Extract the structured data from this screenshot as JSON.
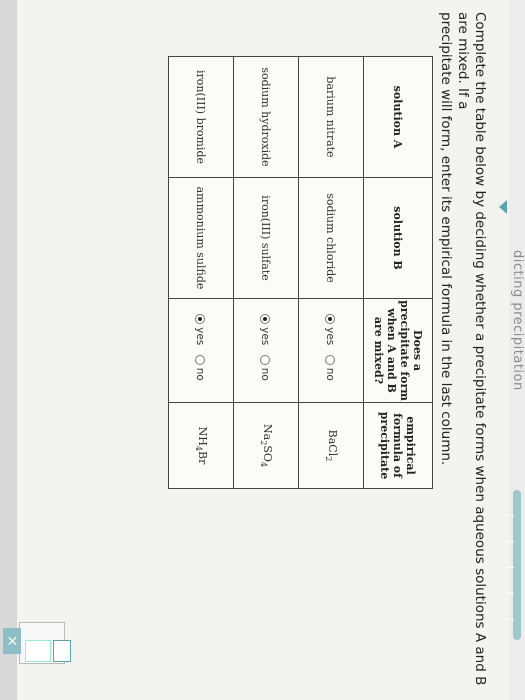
{
  "header": {
    "title": "dicting precipitation"
  },
  "instructions": {
    "line1": "Complete the table below by deciding whether a precipitate forms when aqueous solutions A and B are mixed. If a",
    "line2": "precipitate will form, enter its empirical formula in the last column."
  },
  "table": {
    "headers": {
      "col1": "solution A",
      "col2": "solution B",
      "col3": "Does a precipitate form when A and B are mixed?",
      "col4": "empirical formula of precipitate"
    },
    "rows": [
      {
        "a": "barium nitrate",
        "b": "sodium chloride",
        "selected": "yes",
        "yes_label": "yes",
        "no_label": "no",
        "formula_main": "BaCl",
        "formula_sub": "2"
      },
      {
        "a": "sodium hydroxide",
        "b": "iron(III) sulfate",
        "selected": "yes",
        "yes_label": "yes",
        "no_label": "no",
        "formula_main": "Na",
        "formula_sub": "2",
        "formula_main2": "SO",
        "formula_sub2": "4"
      },
      {
        "a": "iron(III) bromide",
        "b": "ammonium sulfide",
        "selected": "yes",
        "yes_label": "yes",
        "no_label": "no",
        "formula_main": "NH",
        "formula_sub": "4",
        "formula_main2": "Br"
      }
    ]
  },
  "tools": {
    "close_glyph": "×",
    "undo_glyph": "↶"
  },
  "colors": {
    "accent": "#5aa7b0",
    "button": "#8fbfc6"
  }
}
